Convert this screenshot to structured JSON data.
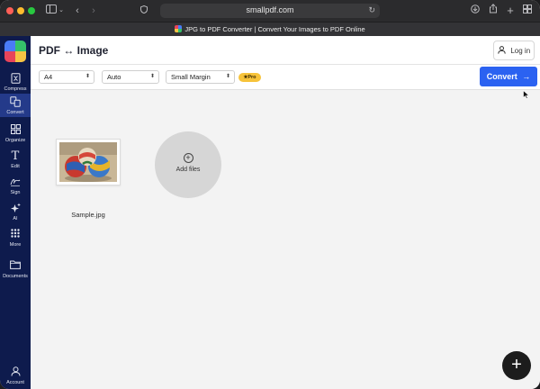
{
  "browser": {
    "url": "smallpdf.com",
    "tab_title": "JPG to PDF Converter | Convert Your Images to PDF Online"
  },
  "sidebar": {
    "items": [
      {
        "label": "Compress",
        "icon": "compress-icon"
      },
      {
        "label": "Convert",
        "icon": "convert-icon"
      },
      {
        "label": "Organize",
        "icon": "organize-icon"
      },
      {
        "label": "Edit",
        "icon": "edit-icon"
      },
      {
        "label": "Sign",
        "icon": "sign-icon"
      },
      {
        "label": "AI",
        "icon": "ai-icon"
      },
      {
        "label": "More",
        "icon": "more-icon"
      },
      {
        "label": "Documents",
        "icon": "folder-icon"
      },
      {
        "label": "Account",
        "icon": "account-icon"
      }
    ],
    "active": "Convert"
  },
  "header": {
    "title": "PDF ↔ Image",
    "login_label": "Log in"
  },
  "options": {
    "page_size": "A4",
    "orientation": "Auto",
    "margin": "Small Margin",
    "pro_badge": "Pro",
    "convert_label": "Convert"
  },
  "main": {
    "file_name": "Sample.jpg",
    "add_files_label": "Add files"
  },
  "colors": {
    "sidebar_bg": "#0e1b4d",
    "accent": "#2b62f1",
    "pro_badge": "#f7c33a"
  }
}
